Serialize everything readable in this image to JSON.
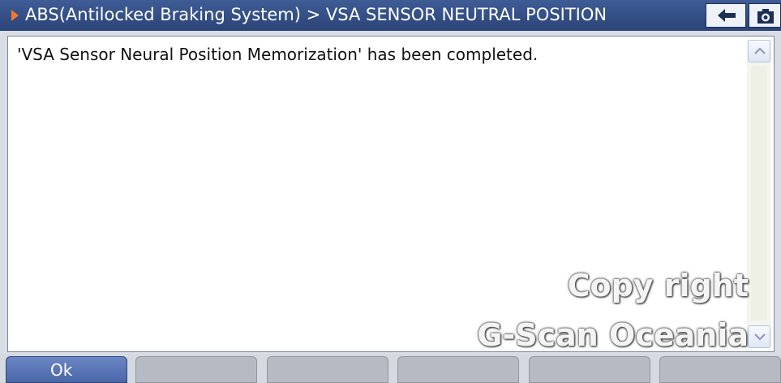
{
  "header": {
    "breadcrumb": "ABS(Antilocked Braking System) > VSA SENSOR NEUTRAL POSITION",
    "back_icon": "arrow-left-icon",
    "screen_icon": "screen-capture-icon"
  },
  "content": {
    "message": "'VSA Sensor Neural Position Memorization' has been completed."
  },
  "watermark": {
    "line1": "Copy right",
    "line2": "G-Scan Oceania"
  },
  "footer": {
    "buttons": [
      "Ok",
      "",
      "",
      "",
      "",
      ""
    ]
  },
  "colors": {
    "titlebar": "#2f4a82",
    "accent_arrow": "#f07a2a",
    "ok_button": "#5672b2",
    "disabled_button": "#b6bbc3"
  }
}
